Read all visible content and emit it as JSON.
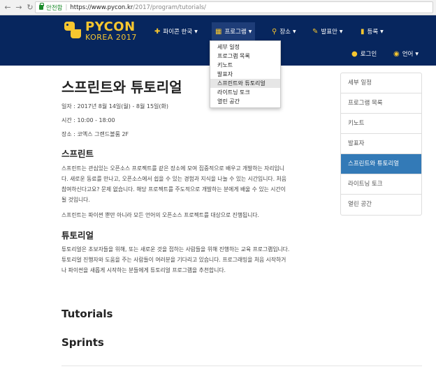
{
  "browser": {
    "secure_label": "안전함",
    "url_host": "https://www.pycon.kr",
    "url_path": "/2017/program/tutorials/"
  },
  "navbar": {
    "logo_title": "PYCON",
    "logo_subtitle": "KOREA 2017",
    "menu": [
      {
        "label": "파이콘 한국",
        "icon": "python-icon"
      },
      {
        "label": "프로그램",
        "icon": "calendar-icon"
      },
      {
        "label": "장소",
        "icon": "map-marker-icon"
      },
      {
        "label": "발표안",
        "icon": "edit-icon"
      },
      {
        "label": "등록",
        "icon": "ticket-icon"
      }
    ],
    "login_label": "로그인",
    "language_label": "언어"
  },
  "dropdown": {
    "items": [
      "세부 일정",
      "프로그램 목록",
      "키노트",
      "발표자",
      "스프린트와 튜토리얼",
      "라이트닝 토크",
      "열린 공간"
    ],
    "active_index": 4
  },
  "content": {
    "title": "스프린트와 튜토리얼",
    "date": "일자 : 2017년 8월 14일(월) - 8월 15일(화)",
    "time": "시간 : 10:00 - 18:00",
    "place": "장소 : 코엑스 그랜드볼룸 2F",
    "sprint_heading": "스프린트",
    "sprint_p1_lines": [
      "스프린트는 관심있는 오픈소스 프로젝트를 같은 장소에 모여 집중적으로 배우고 개발하는 자리입니",
      "다. 새로운 동료를 만나고, 오픈소스에서 쉽을 수 있는 경험과 지식을 나눌 수 있는 시간입니다. 처음",
      "참여하신다고요? 문제 없습니다. 해당 프로젝트를 주도적으로 개발하는 분에게 배울 수 있는 시간이",
      "될 것입니다."
    ],
    "sprint_p2": "스프린트는 파이썬 뿐만 아니라 모든 언어의 오픈소스 프로젝트를 대상으로 진행됩니다.",
    "tutorial_heading": "튜토리얼",
    "tutorial_p_lines": [
      "튜토리얼은 초보자들을 위해, 또는 새로운 것을 접하는 사람들을 위해 진행하는 교육 프로그램입니다.",
      "튜토리얼 진행자와 도움을 주는 사람들이 여러분을 기다리고 있습니다. 프로그래밍을 처음 시작하거",
      "나 파이썬을 새롭게 시작하는 분들에게 튜토리얼 프로그램을 추천합니다."
    ],
    "tutorials_en": "Tutorials",
    "sprints_en": "Sprints"
  },
  "sidebar": {
    "items": [
      "세부 일정",
      "프로그램 목록",
      "키노트",
      "발표자",
      "스프린트와 튜토리얼",
      "라이트닝 토크",
      "열린 공간"
    ],
    "active_index": 4
  },
  "colors": {
    "navbar_bg": "#07265e",
    "brand_yellow": "#f7c62f",
    "sidebar_active": "#337ab7"
  }
}
